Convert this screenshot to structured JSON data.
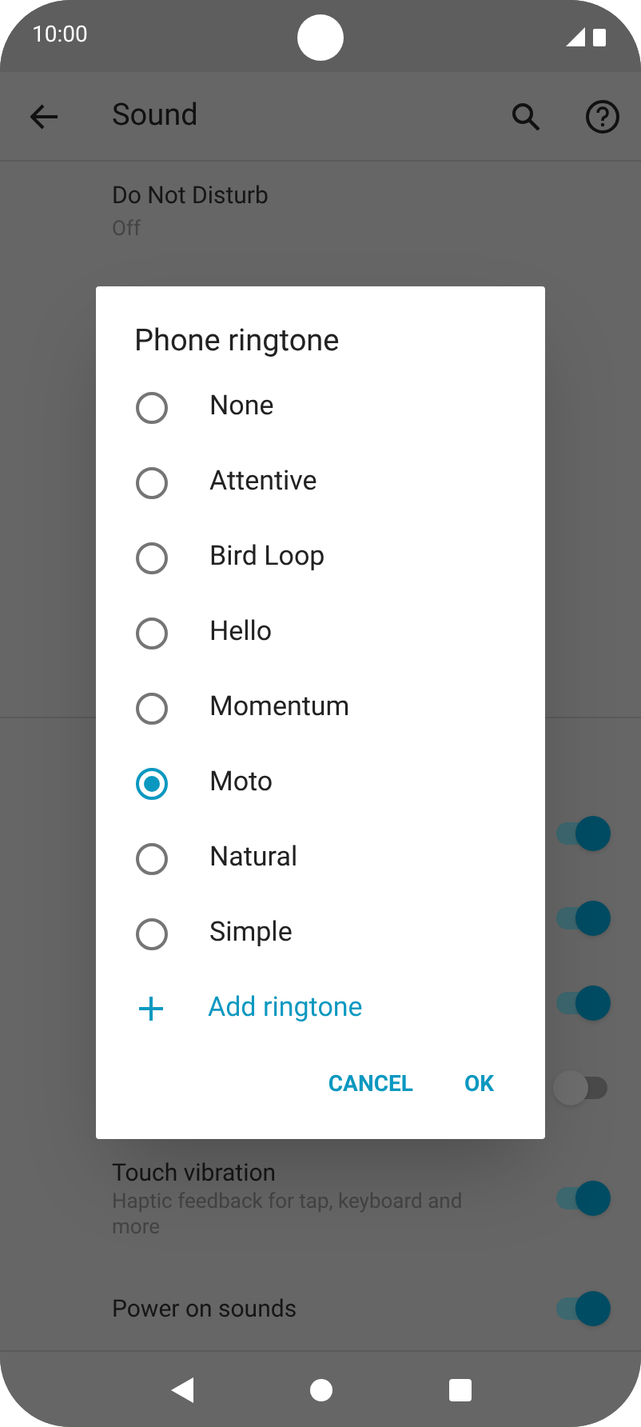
{
  "status_bar": {
    "time": "10:00"
  },
  "app_bar": {
    "title": "Sound"
  },
  "settings_top": [
    {
      "title": "Do Not Disturb",
      "subtitle": "Off"
    }
  ],
  "hidden_toggles": [
    {
      "on": true
    },
    {
      "on": true
    },
    {
      "on": true
    },
    {
      "on": false
    }
  ],
  "settings_bottom": [
    {
      "title": "Touch vibration",
      "subtitle": "Haptic feedback for tap, keyboard and more",
      "on": true
    },
    {
      "title": "Power on sounds",
      "on": true
    }
  ],
  "dialog": {
    "title": "Phone ringtone",
    "options": [
      {
        "label": "None",
        "selected": false
      },
      {
        "label": "Attentive",
        "selected": false
      },
      {
        "label": "Bird Loop",
        "selected": false
      },
      {
        "label": "Hello",
        "selected": false
      },
      {
        "label": "Momentum",
        "selected": false
      },
      {
        "label": "Moto",
        "selected": true
      },
      {
        "label": "Natural",
        "selected": false
      },
      {
        "label": "Simple",
        "selected": false
      }
    ],
    "add_label": "Add ringtone",
    "buttons": [
      "CANCEL",
      "OK"
    ]
  }
}
